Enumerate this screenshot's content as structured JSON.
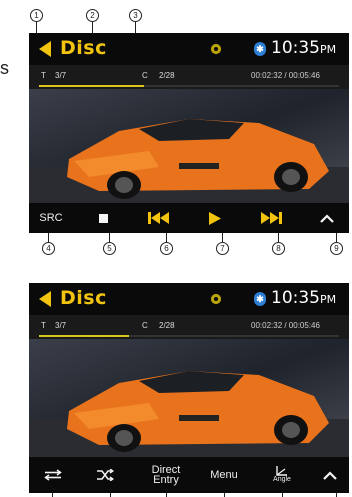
{
  "callouts": [
    "1",
    "2",
    "3",
    "4",
    "5",
    "6",
    "7",
    "8",
    "9"
  ],
  "side_text": "s",
  "screen1": {
    "title": "Disc",
    "clock": "10:35",
    "ampm": "PM",
    "bt_symbol": "✱",
    "track_label": "T",
    "track_value": "3/7",
    "chapter_label": "C",
    "chapter_value": "2/28",
    "time": "00:02:32 / 00:05:46",
    "progress_fraction": 0.35,
    "controls": {
      "src": "SRC"
    }
  },
  "screen2": {
    "title": "Disc",
    "clock": "10:35",
    "ampm": "PM",
    "bt_symbol": "✱",
    "track_label": "T",
    "track_value": "3/7",
    "chapter_label": "C",
    "chapter_value": "2/28",
    "time": "00:02:32 / 00:05:46",
    "progress_fraction": 0.3,
    "controls": {
      "direct_entry_line1": "Direct",
      "direct_entry_line2": "Entry",
      "menu": "Menu",
      "angle": "Angle"
    }
  },
  "colors": {
    "accent": "#f2c40f",
    "bluetooth": "#2d7fd6",
    "background": "#0c0c0c"
  }
}
